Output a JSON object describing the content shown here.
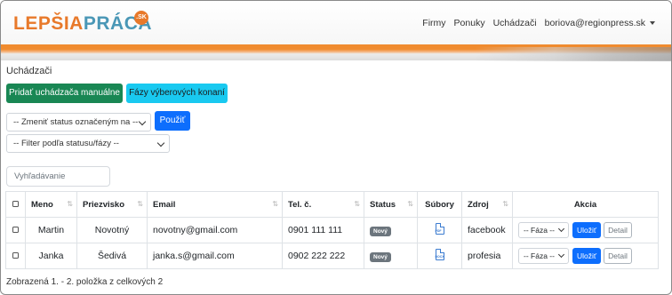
{
  "brand": {
    "part1": "LEPŠIA",
    "part2": "PRÁCA",
    "tld": ".SK"
  },
  "nav": {
    "items": [
      "Firmy",
      "Ponuky",
      "Uchádzači"
    ],
    "user": "boriova@regionpress.sk"
  },
  "page_title": "Uchádzači",
  "actions": {
    "add_candidate": "Pridať uchádzača manuálne",
    "phases": "Fázy výberových konaní",
    "status_select": "-- Zmeniť status označeným na --",
    "apply": "Použiť",
    "filter_select": "-- Filter podľa statusu/fázy --",
    "search_placeholder": "Vyhľadávanie"
  },
  "table": {
    "headers": [
      "Meno",
      "Priezvisko",
      "Email",
      "Tel. č.",
      "Status",
      "Súbory",
      "Zdroj",
      "Akcia"
    ],
    "rows": [
      {
        "first": "Martin",
        "last": "Novotný",
        "email": "novotny@gmail.com",
        "phone": "0901 111 111",
        "status": "Nový",
        "file": "PDF",
        "source": "facebook",
        "phase": "-- Fáza --",
        "save": "Uložiť",
        "detail": "Detail"
      },
      {
        "first": "Janka",
        "last": "Šedivá",
        "email": "janka.s@gmail.com",
        "phone": "0902 222 222",
        "status": "Nový",
        "file": "DOCX",
        "source": "profesia",
        "phase": "-- Fáza --",
        "save": "Uložiť",
        "detail": "Detail"
      }
    ]
  },
  "footer": "Zobrazená 1. - 2. položka z celkových 2",
  "colors": {
    "brand_orange": "#e8792a",
    "brand_blue": "#4a97b6",
    "primary": "#0d6efd",
    "success": "#198754",
    "info": "#19c9f0"
  }
}
